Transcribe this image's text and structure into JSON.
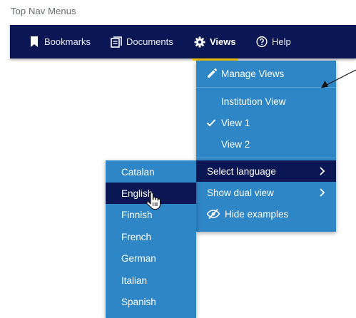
{
  "page": {
    "title": "Top Nav Menus"
  },
  "nav": {
    "items": [
      {
        "label": "Bookmarks",
        "icon": "bookmark-icon"
      },
      {
        "label": "Documents",
        "icon": "documents-icon"
      },
      {
        "label": "Views",
        "icon": "gear-icon",
        "active": true
      },
      {
        "label": "Help",
        "icon": "help-icon"
      }
    ],
    "active_underline_color": "#f2c200",
    "background": "#0b1754"
  },
  "views_menu": {
    "manage": {
      "label": "Manage Views",
      "icon": "pencil-icon"
    },
    "views": [
      {
        "label": "Institution View",
        "checked": false
      },
      {
        "label": "View 1",
        "checked": true
      },
      {
        "label": "View 2",
        "checked": false
      }
    ],
    "options": [
      {
        "label": "Select language",
        "has_submenu": true,
        "highlighted": true
      },
      {
        "label": "Show dual view",
        "has_submenu": true
      },
      {
        "label": "Hide examples",
        "icon": "eye-slash-icon"
      }
    ],
    "background": "#2f86c6",
    "highlight": "#0b1754"
  },
  "language_menu": {
    "items": [
      {
        "label": "Catalan"
      },
      {
        "label": "English",
        "highlighted": true
      },
      {
        "label": "Finnish"
      },
      {
        "label": "French"
      },
      {
        "label": "German"
      },
      {
        "label": "Italian"
      },
      {
        "label": "Spanish"
      }
    ]
  }
}
